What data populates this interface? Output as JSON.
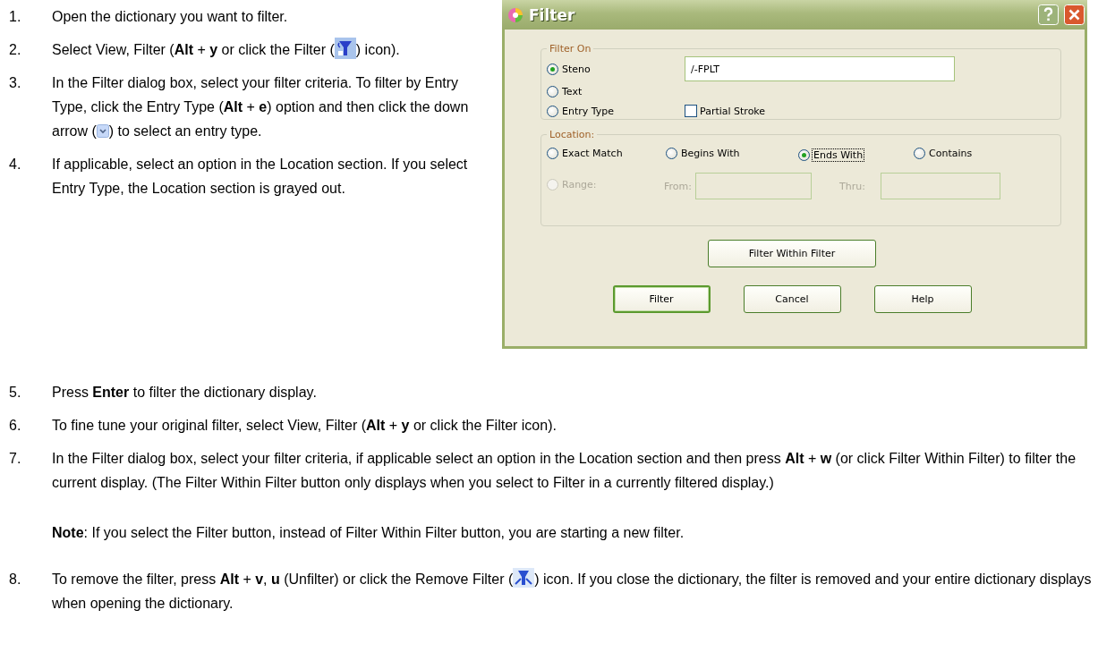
{
  "steps_top": [
    {
      "number": "1.",
      "paragraphs": [
        [
          {
            "kind": "text",
            "text": "Open the dictionary you want to filter."
          }
        ]
      ]
    },
    {
      "number": "2.",
      "paragraphs": [
        [
          {
            "kind": "text",
            "text": "Select View, Filter (**Alt** + **y** or click the Filter ("
          },
          {
            "kind": "filter-icon"
          },
          {
            "kind": "text",
            "text": ") icon)."
          }
        ]
      ]
    },
    {
      "number": "3.",
      "paragraphs": [
        [
          {
            "kind": "text",
            "text": "In the Filter dialog box, select your filter criteria. To filter by Entry Type, click the Entry Type (**Alt** + **e**) option and then click the down arrow ("
          },
          {
            "kind": "dropdown-icon"
          },
          {
            "kind": "text",
            "text": ") to select an entry type."
          }
        ]
      ]
    },
    {
      "number": "4.",
      "paragraphs": [
        [
          {
            "kind": "text",
            "text": "If applicable, select an option in the Location section. If you select Entry Type, the Location section is grayed out."
          }
        ]
      ]
    }
  ],
  "dialog": {
    "title": "Filter",
    "filter_on": {
      "label": "Filter On",
      "options": [
        {
          "label": "Steno",
          "selected": true
        },
        {
          "label": "Text",
          "selected": false
        },
        {
          "label": "Entry Type",
          "selected": false
        }
      ],
      "steno_field": {
        "value": "/-FPLT"
      },
      "partial_stroke": {
        "label": "Partial Stroke",
        "checked": false
      }
    },
    "location": {
      "label": "Location:",
      "options": [
        {
          "label": "Exact Match",
          "selected": false,
          "focused": false
        },
        {
          "label": "Begins With",
          "selected": false,
          "focused": false
        },
        {
          "label": "Ends With",
          "selected": true,
          "focused": true
        },
        {
          "label": "Contains",
          "selected": false,
          "focused": false
        }
      ],
      "range": {
        "label": "Range:",
        "selected": false,
        "disabled": true,
        "from_label": "From:",
        "thru_label": "Thru:"
      }
    },
    "filter_within_button": "Filter Within Filter",
    "buttons": [
      {
        "label": "Filter",
        "default": true
      },
      {
        "label": "Cancel",
        "default": false
      },
      {
        "label": "Help",
        "default": false
      }
    ]
  },
  "steps_bottom": [
    {
      "number": "5.",
      "paragraphs": [
        [
          {
            "kind": "text",
            "text": "Press **Enter** to filter the dictionary display."
          }
        ]
      ]
    },
    {
      "number": "6.",
      "paragraphs": [
        [
          {
            "kind": "text",
            "text": "To fine tune your original filter, select View, Filter (**Alt** + **y** or click the Filter icon)."
          }
        ]
      ]
    },
    {
      "number": "7.",
      "paragraphs": [
        [
          {
            "kind": "text",
            "text": "In the Filter dialog box, select your filter criteria, if applicable select an option in the Location section and then press **Alt** + **w** (or click Filter Within Filter) to filter the current display. (The Filter Within Filter button only displays when you select to Filter in a currently filtered display.)"
          }
        ],
        [
          {
            "kind": "text",
            "text": "**Note**: If you select the Filter button, instead of Filter Within Filter button, you are starting a new filter."
          }
        ]
      ]
    },
    {
      "number": "8.",
      "paragraphs": [
        [
          {
            "kind": "text",
            "text": "To remove the filter, press **Alt** + **v**, **u** (Unfilter) or click the Remove Filter ("
          },
          {
            "kind": "unfilter-icon"
          },
          {
            "kind": "text",
            "text": ") icon. If you close the dictionary, the filter is removed and your entire dictionary displays when opening the dictionary."
          }
        ]
      ]
    }
  ]
}
